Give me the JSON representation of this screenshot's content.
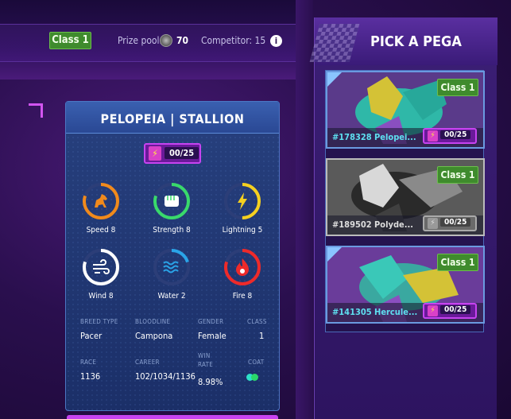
{
  "topbar": {
    "class_label": "Class 1",
    "prize_label": "Prize pool:",
    "prize_value": "70",
    "competitor_label": "Competitor: 15",
    "info_icon": "info-icon"
  },
  "card": {
    "title": "PELOPEIA | STALLION",
    "energy": "00/25",
    "stats": [
      {
        "label": "Speed 8",
        "icon": "horse-icon",
        "color": "#f08a1c",
        "value": 8
      },
      {
        "label": "Strength 8",
        "icon": "fist-icon",
        "color": "#39d96b",
        "value": 8
      },
      {
        "label": "Lightning 5",
        "icon": "lightning-icon",
        "color": "#f5d020",
        "value": 5
      },
      {
        "label": "Wind 8",
        "icon": "wind-icon",
        "color": "#ffffff",
        "value": 8
      },
      {
        "label": "Water 2",
        "icon": "water-icon",
        "color": "#2aa4e8",
        "value": 2
      },
      {
        "label": "Fire 8",
        "icon": "fire-icon",
        "color": "#ee2a2a",
        "value": 8
      }
    ],
    "info": {
      "breed_type_key": "BREED TYPE",
      "breed_type": "Pacer",
      "bloodline_key": "BLOODLINE",
      "bloodline": "Campona",
      "gender_key": "GENDER",
      "gender": "Female",
      "class_key": "CLASS",
      "class": "1",
      "race_key": "RACE",
      "race": "1136",
      "career_key": "CAREER",
      "career": "102/1034/1136",
      "win_rate_key_1": "WIN",
      "win_rate_key_2": "RATE",
      "win_rate": "8.98%",
      "coat_key": "COAT"
    }
  },
  "pick_panel": {
    "title": "PICK A PEGA",
    "pegas": [
      {
        "name": "#178328 Pelopei...",
        "class": "Class 1",
        "energy": "00/25",
        "disabled": false
      },
      {
        "name": "#189502 Polyde...",
        "class": "Class 1",
        "energy": "00/25",
        "disabled": true
      },
      {
        "name": "#141305 Hercule...",
        "class": "Class 1",
        "energy": "00/25",
        "disabled": false
      }
    ]
  },
  "colors": {
    "accent_purple": "#c743f0",
    "class_green": "#3f8b2d",
    "cyan_name": "#5ee0f0"
  }
}
